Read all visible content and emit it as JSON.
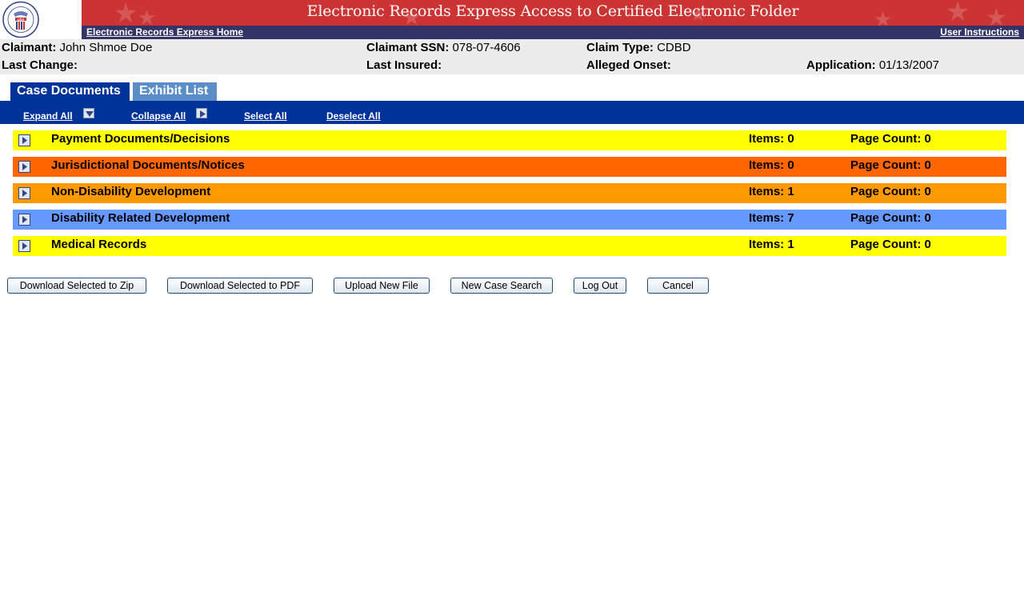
{
  "header": {
    "title": "Electronic Records Express Access to Certified Electronic Folder",
    "logo_icon": "ssa-seal-icon",
    "logo_text": "SOCIAL SECURITY ADMINISTRATION USA",
    "nav_home": "Electronic Records Express Home",
    "nav_instructions": "User Instructions",
    "colors": {
      "banner": "#cc3333",
      "navbar": "#333366"
    }
  },
  "claimant": {
    "claimant_label": "Claimant:",
    "claimant_value": "John Shmoe Doe",
    "ssn_label": "Claimant SSN:",
    "ssn_value": "078-07-4606",
    "claim_type_label": "Claim Type:",
    "claim_type_value": "CDBD",
    "last_change_label": "Last Change:",
    "last_change_value": "",
    "last_insured_label": "Last Insured:",
    "last_insured_value": "",
    "onset_label": "Alleged Onset:",
    "onset_value": "",
    "application_label": "Application:",
    "application_value": "01/13/2007"
  },
  "tabs": [
    {
      "label": "Case Documents",
      "active": true
    },
    {
      "label": "Exhibit List",
      "active": false
    }
  ],
  "toolbar": {
    "expand_all": "Expand All",
    "expand_icon": "chevron-down-icon",
    "collapse_all": "Collapse All",
    "collapse_icon": "chevron-right-icon",
    "select_all": "Select All",
    "deselect_all": "Deselect All"
  },
  "categories": [
    {
      "name": "Payment Documents/Decisions",
      "items": "Items: 0",
      "pages": "Page Count: 0",
      "color": "#ffff00"
    },
    {
      "name": "Jurisdictional Documents/Notices",
      "items": "Items: 0",
      "pages": "Page Count: 0",
      "color": "#ff6600"
    },
    {
      "name": "Non-Disability Development",
      "items": "Items: 1",
      "pages": "Page Count: 0",
      "color": "#ff9900"
    },
    {
      "name": "Disability Related Development",
      "items": "Items: 7",
      "pages": "Page Count: 0",
      "color": "#6699ff"
    },
    {
      "name": "Medical Records",
      "items": "Items: 1",
      "pages": "Page Count: 0",
      "color": "#ffff00"
    }
  ],
  "buttons": {
    "download_zip": "Download Selected to Zip",
    "download_pdf": "Download Selected to PDF",
    "upload": "Upload New File",
    "new_search": "New Case Search",
    "logout": "Log Out",
    "cancel": "Cancel"
  }
}
